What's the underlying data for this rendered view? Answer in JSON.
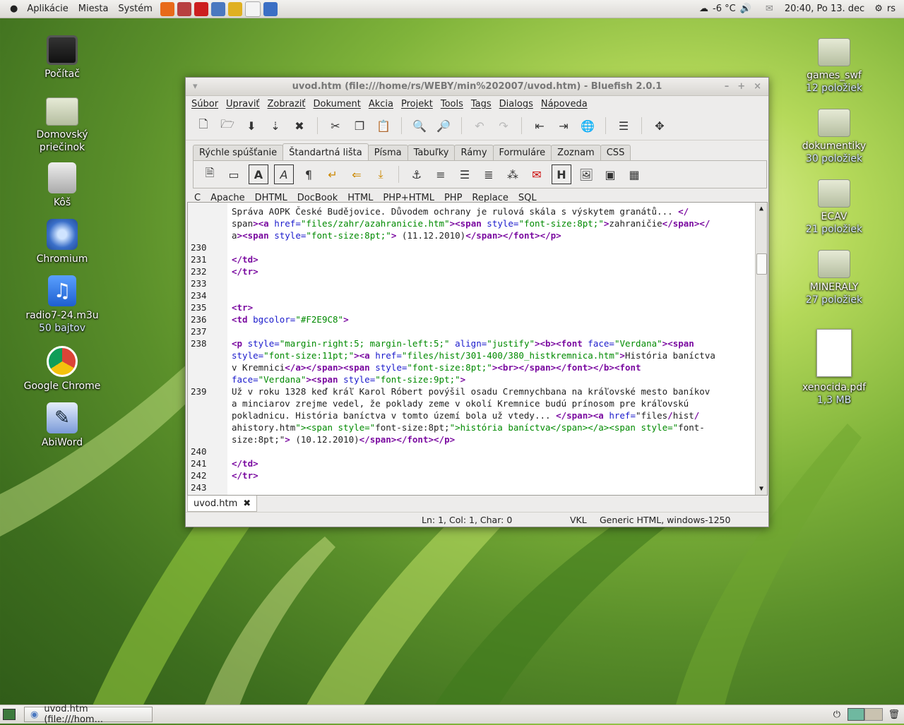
{
  "top_panel": {
    "menus": [
      "Aplikácie",
      "Miesta",
      "Systém"
    ],
    "launchers": [
      "firefox-icon",
      "image-icon",
      "filezilla-icon",
      "network-icon",
      "bluefish-icon",
      "text-editor-icon",
      "chromium-small-icon"
    ],
    "weather": "-6 °C",
    "clock": "20:40, Po 13. dec",
    "user": "rs"
  },
  "desktop_left": [
    {
      "label": "Počítač",
      "sub": "",
      "icon": "computer-icon"
    },
    {
      "label": "Domovský priečinok",
      "sub": "",
      "icon": "home-folder-icon"
    },
    {
      "label": "Kôš",
      "sub": "",
      "icon": "trash-icon"
    },
    {
      "label": "Chromium",
      "sub": "",
      "icon": "chromium-icon"
    },
    {
      "label": "radio7-24.m3u",
      "sub": "50 bajtov",
      "icon": "music-file-icon"
    },
    {
      "label": "Google Chrome",
      "sub": "",
      "icon": "chrome-icon"
    },
    {
      "label": "AbiWord",
      "sub": "",
      "icon": "abiword-icon"
    }
  ],
  "desktop_right": [
    {
      "label": "games_swf",
      "sub": "12 položiek",
      "icon": "folder-icon"
    },
    {
      "label": "dokumentiky",
      "sub": "30 položiek",
      "icon": "folder-icon"
    },
    {
      "label": "ECAV",
      "sub": "21 položiek",
      "icon": "folder-icon"
    },
    {
      "label": "MINERALY",
      "sub": "27 položiek",
      "icon": "folder-icon"
    },
    {
      "label": "xenocida.pdf",
      "sub": "1,3 MB",
      "icon": "pdf-file-icon"
    }
  ],
  "window": {
    "title": "uvod.htm (file:///home/rs/WEBY/min%202007/uvod.htm) - Bluefish 2.0.1",
    "menu": [
      "Súbor",
      "Upraviť",
      "Zobraziť",
      "Dokument",
      "Akcia",
      "Projekt",
      "Tools",
      "Tags",
      "Dialogs",
      "Nápoveda"
    ],
    "tabs": [
      "Rýchle spúšťanie",
      "Štandartná lišta",
      "Písma",
      "Tabuľky",
      "Rámy",
      "Formuláre",
      "Zoznam",
      "CSS"
    ],
    "active_tab": "Štandartná lišta",
    "html_bar": [
      "C",
      "Apache",
      "DHTML",
      "DocBook",
      "HTML",
      "PHP+HTML",
      "PHP",
      "Replace",
      "SQL"
    ],
    "doc_tab": "uvod.htm",
    "status": {
      "position": "Ln: 1, Col: 1, Char: 0",
      "mode": "VKL",
      "encoding": "Generic HTML, windows-1250"
    }
  },
  "editor_lines": [
    {
      "n": "",
      "code": "Správa AOPK České Budějovice. Důvodem ochrany je rulová skála s výskytem granátů... </"
    },
    {
      "n": "",
      "code": "span><a href=\"files/zahr/azahranicie.htm\"><span style=\"font-size:8pt;\">zahraničie</span></"
    },
    {
      "n": "",
      "code": "a><span style=\"font-size:8pt;\"> (11.12.2010)</span></font></p>"
    },
    {
      "n": "230",
      "code": ""
    },
    {
      "n": "231",
      "code": "</td>"
    },
    {
      "n": "232",
      "code": "</tr>"
    },
    {
      "n": "233",
      "code": ""
    },
    {
      "n": "234",
      "code": ""
    },
    {
      "n": "235",
      "code": "<tr>"
    },
    {
      "n": "236",
      "code": "<td bgcolor=\"#F2E9C8\">"
    },
    {
      "n": "237",
      "code": ""
    },
    {
      "n": "238",
      "code": "<p style=\"margin-right:5; margin-left:5;\" align=\"justify\"><b><font face=\"Verdana\"><span"
    },
    {
      "n": "",
      "code": "style=\"font-size:11pt;\"><a href=\"files/hist/301-400/380_histkremnica.htm\">História baníctva"
    },
    {
      "n": "",
      "code": "v Kremnici</a></span><span style=\"font-size:8pt;\"><br></span></font></b><font"
    },
    {
      "n": "",
      "code": "face=\"Verdana\"><span style=\"font-size:9pt;\">"
    },
    {
      "n": "239",
      "code": "Už v roku 1328 keď kráľ Karol Róbert povýšil osadu Cremnychbana na kráľovské mesto baníkov"
    },
    {
      "n": "",
      "code": "a minciarov zrejme vedel, že poklady zeme v okolí Kremnice budú prínosom pre kráľovskú"
    },
    {
      "n": "",
      "code": "pokladnicu. História baníctva v tomto území bola už vtedy... </span><a href=\"files/hist/"
    },
    {
      "n": "",
      "code": "ahistory.htm\"><span style=\"font-size:8pt;\">história baníctva</span></a><span style=\"font-"
    },
    {
      "n": "",
      "code": "size:8pt;\"> (10.12.2010)</span></font></p>"
    },
    {
      "n": "240",
      "code": ""
    },
    {
      "n": "241",
      "code": "</td>"
    },
    {
      "n": "242",
      "code": "</tr>"
    },
    {
      "n": "243",
      "code": ""
    }
  ],
  "taskbar": {
    "label": "uvod.htm (file:///hom..."
  }
}
